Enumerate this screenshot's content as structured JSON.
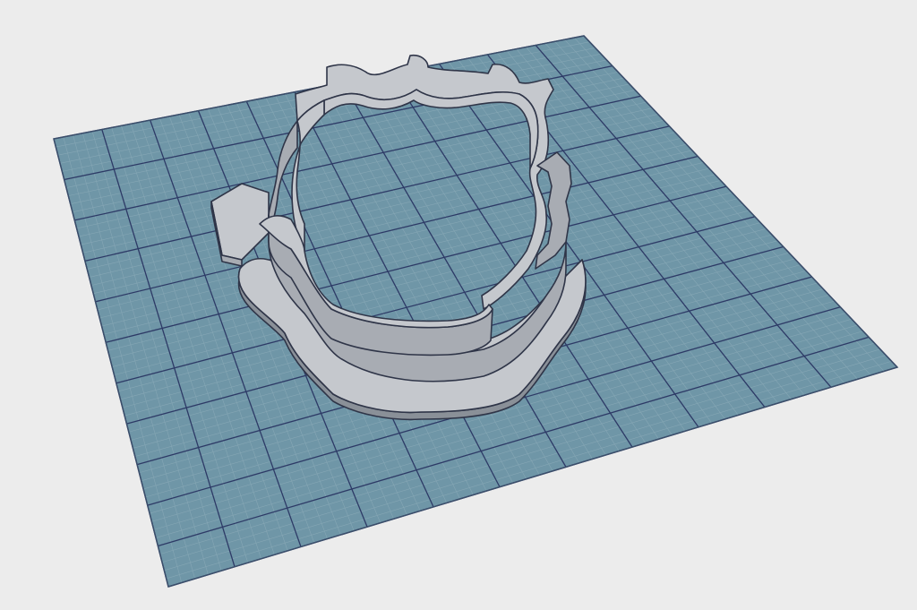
{
  "viewport": {
    "background": "#ececec"
  },
  "build_plate": {
    "fill": "#6f96a7",
    "minor_grid_color": "#86a7b5",
    "major_grid_color": "#2d3a66",
    "outline_color": "#3a4d6a",
    "minor_subdivisions": 5,
    "major_cells": 11
  },
  "model": {
    "name": "cookie-cutter",
    "face_color": "#c5c8cd",
    "side_color": "#a8acb3",
    "edge_color": "#2f3548",
    "shadow_color": "#8a9098"
  }
}
